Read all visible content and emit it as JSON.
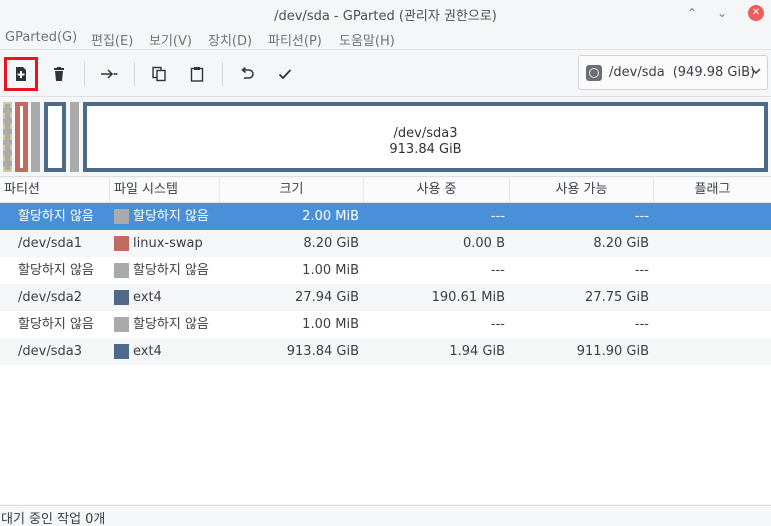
{
  "window": {
    "title": "/dev/sda - GParted (관리자 권한으로)",
    "controls": {
      "minimize": "⌃",
      "maximize": "⌄",
      "close": "✕"
    }
  },
  "menu": [
    "GParted(G)",
    "편집(E)",
    "보기(V)",
    "장치(D)",
    "파티션(P)",
    "도움말(H)"
  ],
  "toolbar": {
    "icons": [
      "new-partition-icon",
      "delete-icon",
      "resize-move-icon",
      "copy-icon",
      "paste-icon",
      "undo-icon",
      "apply-icon"
    ],
    "device": {
      "label": "/dev/sda",
      "size": "(949.98 GiB)"
    }
  },
  "diskmap": {
    "selected_label": "/dev/sda3",
    "selected_size": "913.84 GiB"
  },
  "colors": {
    "unallocated": "#a9aaab",
    "linux_swap": "#c26a5f",
    "ext4": "#4e6a88",
    "selection": "#4a90d9",
    "highlight": "#e8141e"
  },
  "table": {
    "headers": [
      "파티션",
      "파일 시스템",
      "크기",
      "사용 중",
      "사용 가능",
      "플래그"
    ],
    "rows": [
      {
        "partition": "할당하지 않음",
        "fs": "할당하지 않음",
        "fs_color": "#a9aaab",
        "size": "2.00 MiB",
        "used": "---",
        "free": "---",
        "flags": "",
        "selected": true
      },
      {
        "partition": "/dev/sda1",
        "fs": "linux-swap",
        "fs_color": "#c26a5f",
        "size": "8.20 GiB",
        "used": "0.00 B",
        "free": "8.20 GiB",
        "flags": ""
      },
      {
        "partition": "할당하지 않음",
        "fs": "할당하지 않음",
        "fs_color": "#a9aaab",
        "size": "1.00 MiB",
        "used": "---",
        "free": "---",
        "flags": ""
      },
      {
        "partition": "/dev/sda2",
        "fs": "ext4",
        "fs_color": "#4e6a88",
        "size": "27.94 GiB",
        "used": "190.61 MiB",
        "free": "27.75 GiB",
        "flags": ""
      },
      {
        "partition": "할당하지 않음",
        "fs": "할당하지 않음",
        "fs_color": "#a9aaab",
        "size": "1.00 MiB",
        "used": "---",
        "free": "---",
        "flags": ""
      },
      {
        "partition": "/dev/sda3",
        "fs": "ext4",
        "fs_color": "#4e6a88",
        "size": "913.84 GiB",
        "used": "1.94 GiB",
        "free": "911.90 GiB",
        "flags": ""
      }
    ]
  },
  "status": "대기 중인 작업 0개"
}
